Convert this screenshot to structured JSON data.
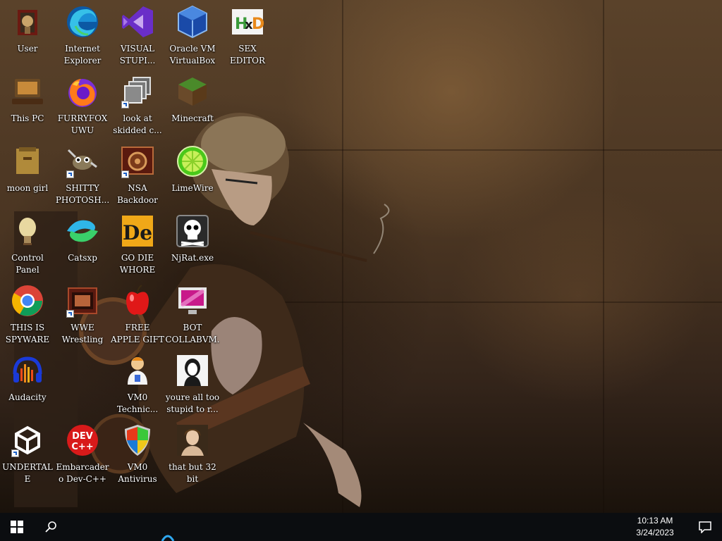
{
  "desktop": {
    "icons": [
      {
        "label": "User",
        "icon": "user-folder-icon"
      },
      {
        "label": "Internet Explorer",
        "icon": "edge-browser-icon"
      },
      {
        "label": "VISUAL STUPI...",
        "icon": "visual-studio-icon"
      },
      {
        "label": "Oracle VM VirtualBox",
        "icon": "virtualbox-icon"
      },
      {
        "label": "SEX EDITOR",
        "icon": "hxd-editor-icon"
      },
      {
        "label": "This PC",
        "icon": "computer-icon"
      },
      {
        "label": "FURRYFOX UWU",
        "icon": "firefox-icon"
      },
      {
        "label": "look at skidded c...",
        "icon": "stacked-windows-icon"
      },
      {
        "label": "Minecraft",
        "icon": "minecraft-block-icon"
      },
      {
        "label": "moon girl",
        "icon": "folder-icon"
      },
      {
        "label": "SHITTY PHOTOSH...",
        "icon": "gimp-icon"
      },
      {
        "label": "NSA Backdoor",
        "icon": "gear-shortcut-icon"
      },
      {
        "label": "LimeWire",
        "icon": "limewire-icon"
      },
      {
        "label": "Control Panel",
        "icon": "control-panel-icon"
      },
      {
        "label": "Catsxp",
        "icon": "catsxp-browser-icon"
      },
      {
        "label": "GO DIE WHORE",
        "icon": "de-editor-icon"
      },
      {
        "label": "NjRat.exe",
        "icon": "skull-icon"
      },
      {
        "label": "THIS IS SPYWARE",
        "icon": "chrome-icon"
      },
      {
        "label": "WWE Wrestling",
        "icon": "game-window-icon"
      },
      {
        "label": "FREE APPLE GIFT CAR...",
        "icon": "apple-icon"
      },
      {
        "label": "BOT COLLABVM...",
        "icon": "monitor-icon"
      },
      {
        "label": "Audacity",
        "icon": "audacity-icon"
      },
      {
        "label": "VM0 Technic...",
        "icon": "technician-icon"
      },
      {
        "label": "youre all too stupid to r...",
        "icon": "portrait-image-icon"
      },
      {
        "label": "UNDERTALE",
        "icon": "unity-icon"
      },
      {
        "label": "Embarcadero Dev-C++",
        "icon": "devcpp-icon"
      },
      {
        "label": "VM0 Antivirus",
        "icon": "shield-icon"
      },
      {
        "label": "that but 32 bit",
        "icon": "portrait-painting-icon"
      }
    ]
  },
  "taskbar": {
    "time": "10:13 AM",
    "date": "3/24/2023",
    "start": "windows-start-icon",
    "search": "search-icon",
    "notifications": "notification-icon"
  }
}
